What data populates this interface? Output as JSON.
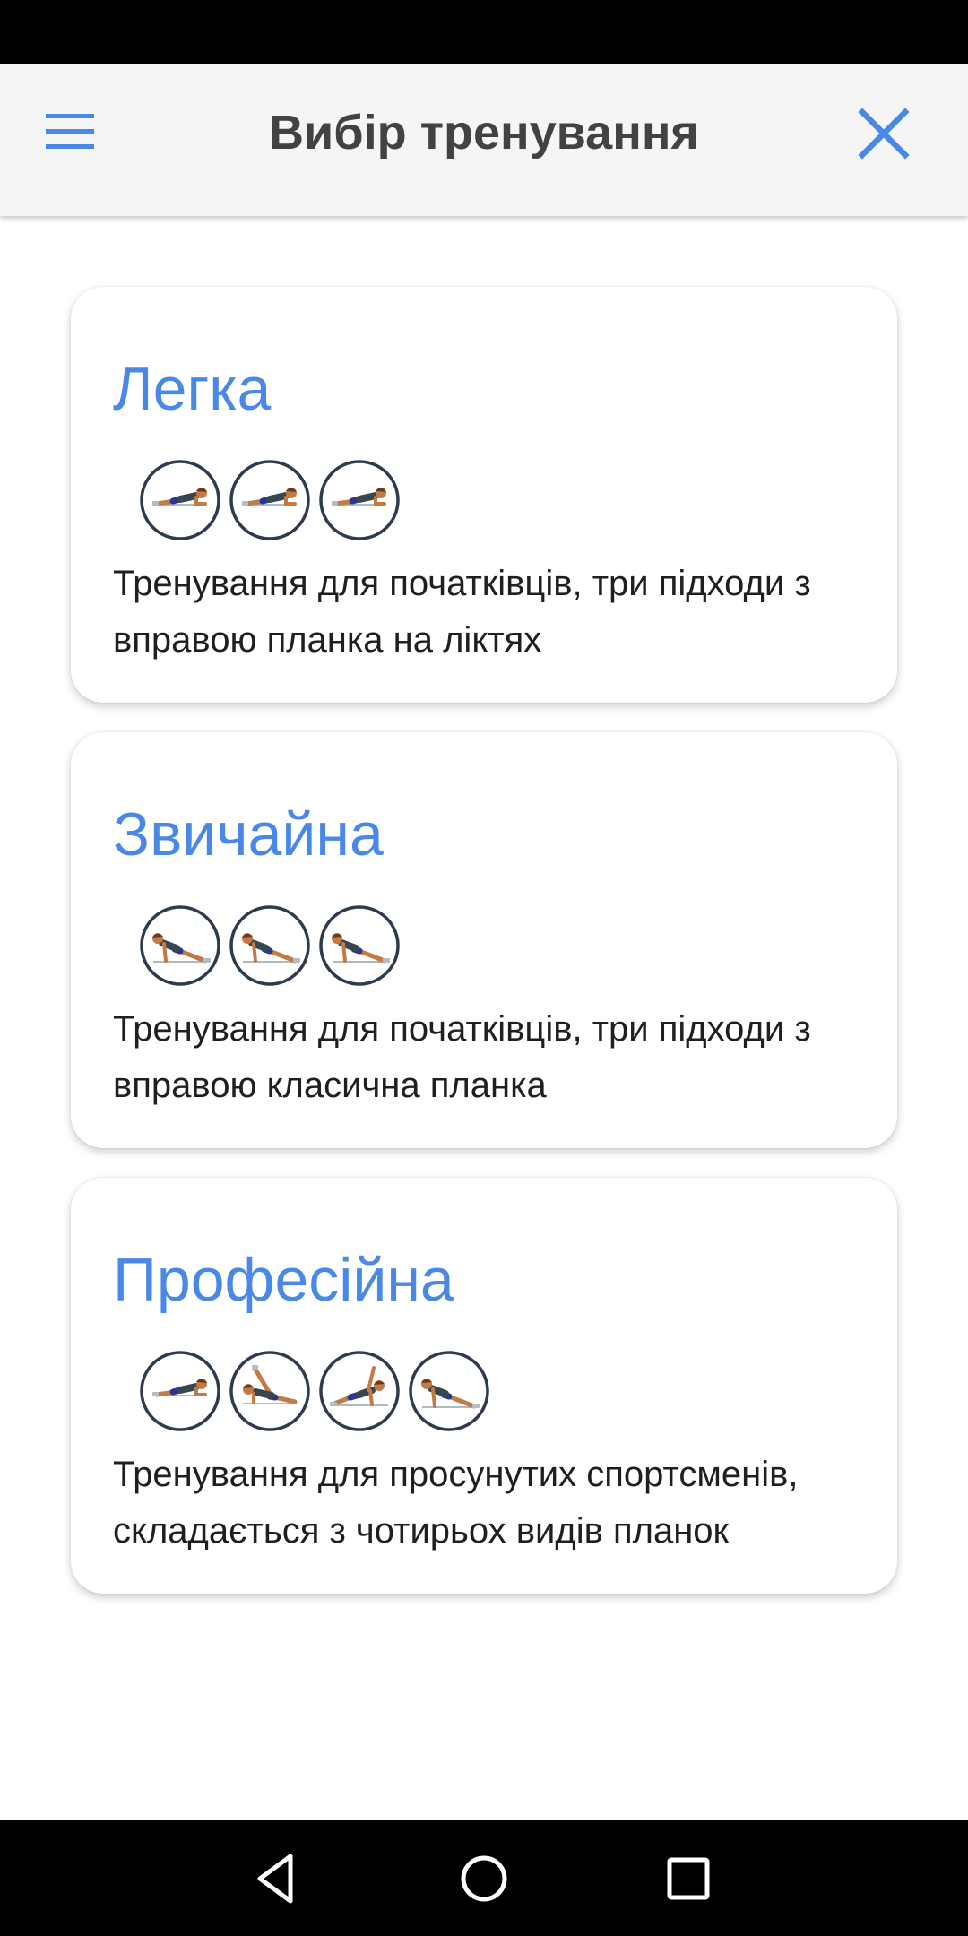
{
  "app_bar": {
    "title": "Вибір тренування",
    "accent_color": "#4a88e8",
    "menu_icon": "hamburger-menu-icon",
    "close_icon": "close-x-icon"
  },
  "workouts": [
    {
      "title": "Легка",
      "description": "Тренування для початківців, три підходи з вправою планка на ліктях",
      "exercises": [
        "elbow-plank",
        "elbow-plank",
        "elbow-plank"
      ]
    },
    {
      "title": "Звичайна",
      "description": "Тренування для початківців, три підходи з вправою класична планка",
      "exercises": [
        "high-plank",
        "high-plank",
        "high-plank"
      ]
    },
    {
      "title": "Професійна",
      "description": "Тренування для просунутих спортсменів, складається з чотирьох видів планок",
      "exercises": [
        "elbow-plank",
        "leg-raise-plank",
        "side-plank",
        "high-plank"
      ]
    }
  ],
  "nav_bar": {
    "back_icon": "back-triangle-icon",
    "home_icon": "home-circle-icon",
    "recents_icon": "recents-square-icon"
  }
}
